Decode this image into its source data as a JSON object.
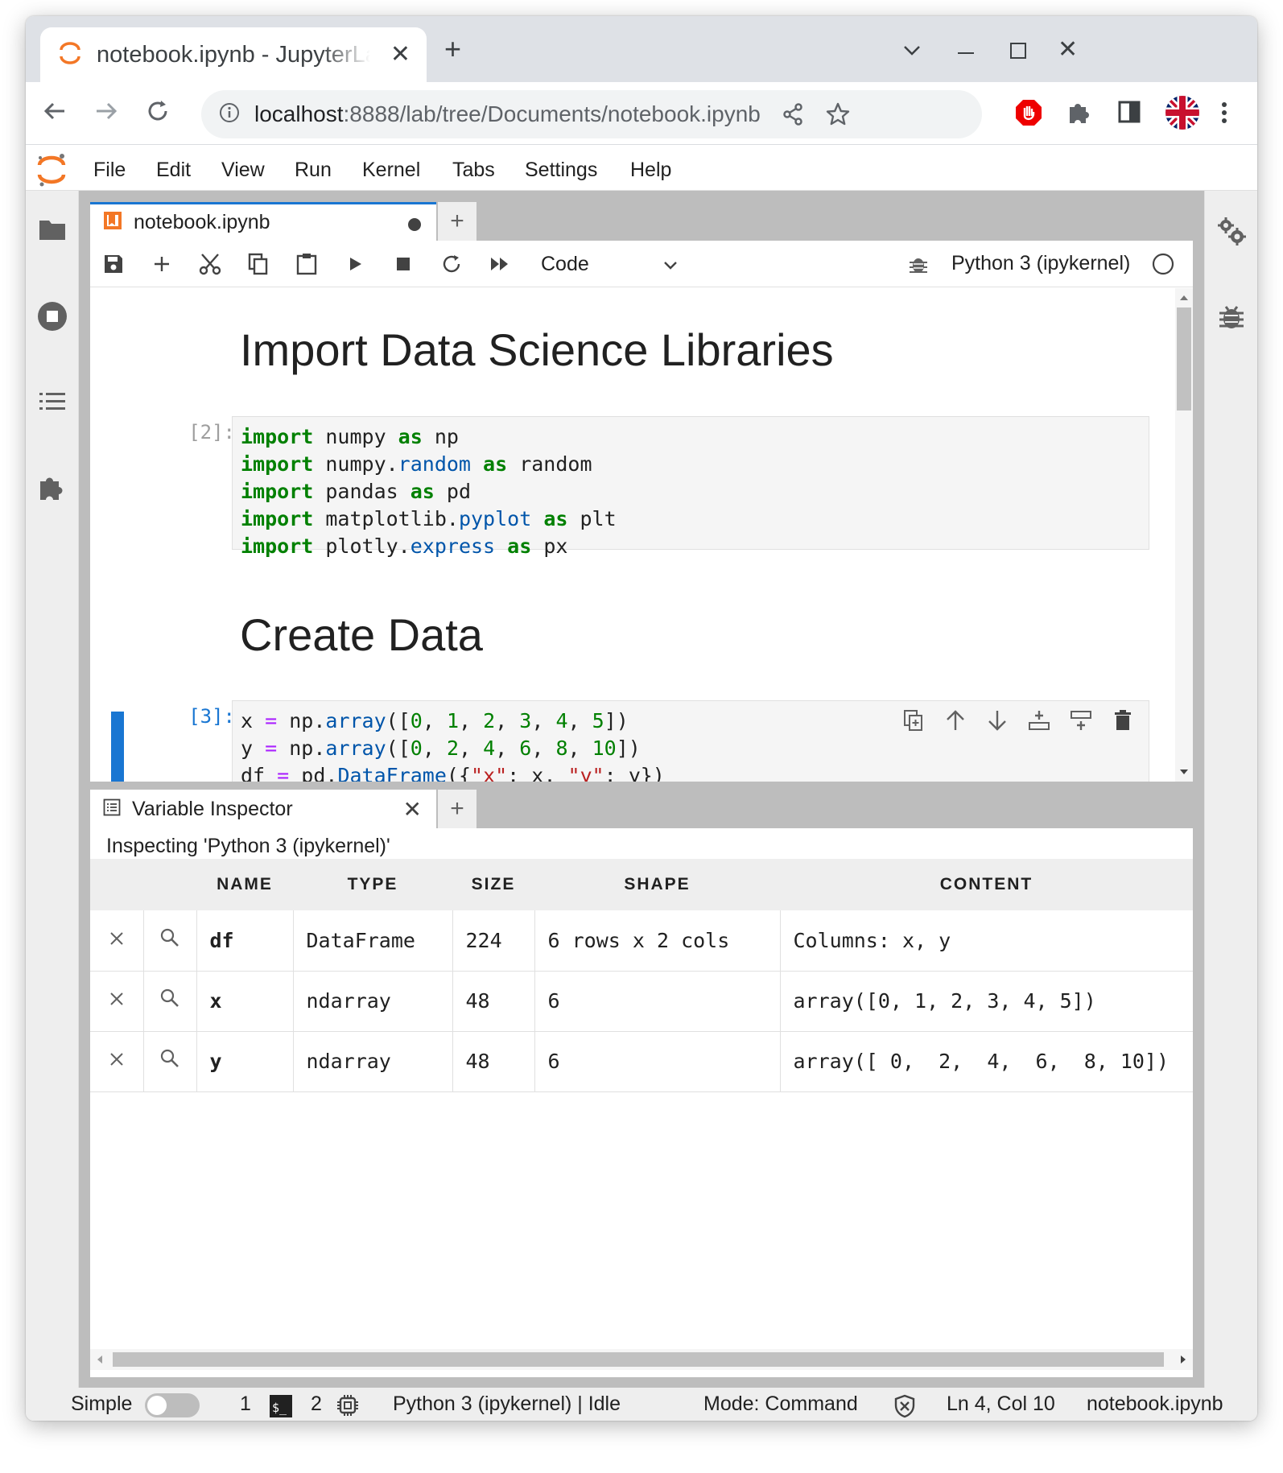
{
  "browser": {
    "tab_title": "notebook.ipynb - JupyterLab",
    "url_host": "localhost",
    "url_path": ":8888/lab/tree/Documents/notebook.ipynb"
  },
  "menu": {
    "items": [
      "File",
      "Edit",
      "View",
      "Run",
      "Kernel",
      "Tabs",
      "Settings",
      "Help"
    ]
  },
  "notebook": {
    "tab_label": "notebook.ipynb",
    "cell_type": "Code",
    "kernel": "Python 3 (ipykernel)",
    "heading1": "Import Data Science Libraries",
    "heading2": "Create Data",
    "cell2_prompt": "[2]:",
    "cell3_prompt": "[3]:",
    "cell2_lines": [
      "import numpy as np",
      "import numpy.random as random",
      "import pandas as pd",
      "import matplotlib.pyplot as plt",
      "import plotly.express as px"
    ],
    "cell3_lines": [
      "x = np.array([0, 1, 2, 3, 4, 5])",
      "y = np.array([0, 2, 4, 6, 8, 10])",
      "df = pd.DataFrame({\"x\": x, \"y\": y})"
    ]
  },
  "inspector": {
    "tab_label": "Variable Inspector",
    "subtitle": "Inspecting 'Python 3 (ipykernel)'",
    "columns": [
      "NAME",
      "TYPE",
      "SIZE",
      "SHAPE",
      "CONTENT"
    ],
    "rows": [
      {
        "name": "df",
        "type": "DataFrame",
        "size": "224",
        "shape": "6 rows x 2 cols",
        "content": "Columns: x, y"
      },
      {
        "name": "x",
        "type": "ndarray",
        "size": "48",
        "shape": "6",
        "content": "array([0, 1, 2, 3, 4, 5])"
      },
      {
        "name": "y",
        "type": "ndarray",
        "size": "48",
        "shape": "6",
        "content": "array([ 0,  2,  4,  6,  8, 10])"
      }
    ]
  },
  "status": {
    "mode_label": "Simple",
    "count1": "1",
    "count2": "2",
    "kernel_state": "Python 3 (ipykernel) | Idle",
    "mode": "Mode: Command",
    "position": "Ln 4, Col 10",
    "file": "notebook.ipynb"
  },
  "colors": {
    "accent": "#1976d2",
    "jupyter_orange": "#f37726",
    "keyword": "#008000"
  }
}
